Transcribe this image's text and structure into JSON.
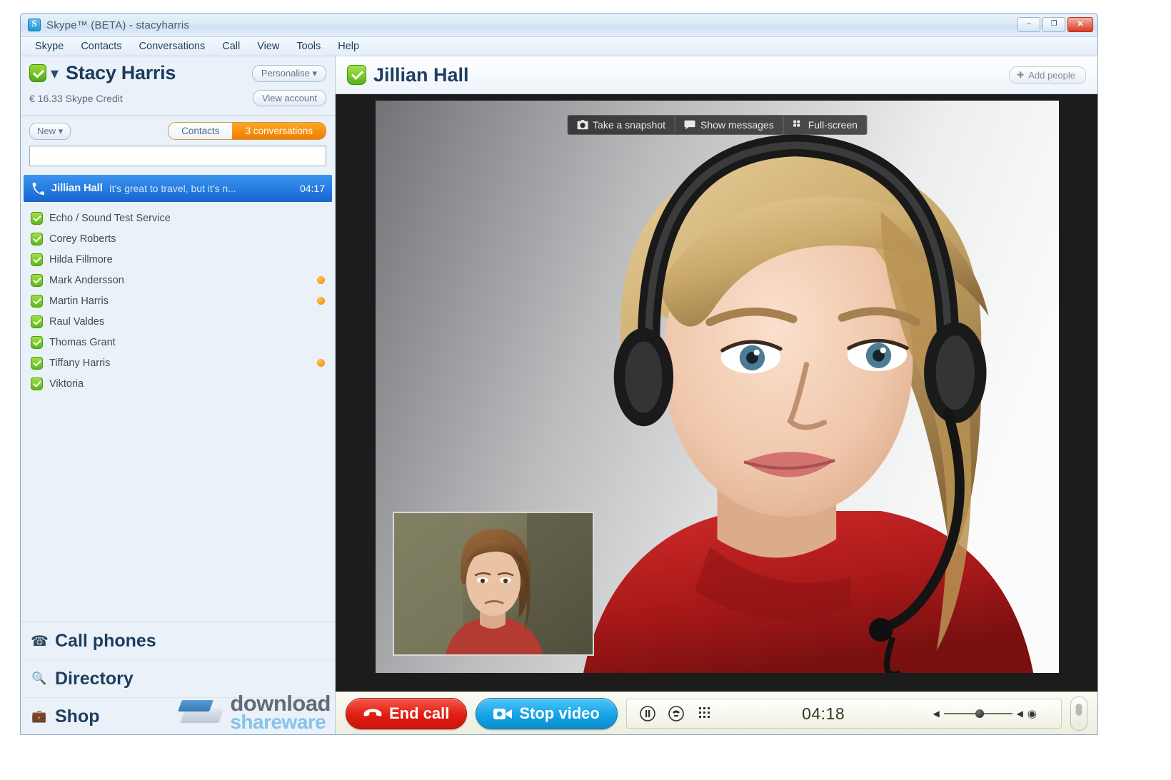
{
  "window": {
    "title": "Skype™ (BETA) - stacyharris",
    "icon": "skype-logo-icon",
    "minimize": "–",
    "maximize": "❐",
    "close": "✕"
  },
  "menubar": {
    "items": [
      "Skype",
      "Contacts",
      "Conversations",
      "Call",
      "View",
      "Tools",
      "Help"
    ]
  },
  "sidebar": {
    "account": {
      "name": "Stacy Harris",
      "presence": "online",
      "personalise_label": "Personalise",
      "personalise_caret": "▾",
      "credit": "€ 16.33 Skype Credit",
      "view_account_label": "View account"
    },
    "toolbar": {
      "new_label": "New",
      "new_caret": "▾",
      "tab_contacts": "Contacts",
      "tab_conversations": "3 conversations",
      "active_tab": "3 conversations"
    },
    "search": {
      "value": "",
      "placeholder": ""
    },
    "conversation": {
      "name": "Jillian Hall",
      "preview": "It's great to travel, but it's n...",
      "time": "04:17",
      "icon": "phone-icon",
      "selected": true
    },
    "contacts": [
      {
        "name": "Echo / Sound Test Service",
        "presence": "online",
        "badge": false
      },
      {
        "name": "Corey Roberts",
        "presence": "online",
        "badge": false
      },
      {
        "name": "Hilda Fillmore",
        "presence": "online",
        "badge": false
      },
      {
        "name": "Mark Andersson",
        "presence": "online",
        "badge": true
      },
      {
        "name": "Martin Harris",
        "presence": "online",
        "badge": true
      },
      {
        "name": "Raul Valdes",
        "presence": "online",
        "badge": false
      },
      {
        "name": "Thomas Grant",
        "presence": "online",
        "badge": false
      },
      {
        "name": "Tiffany Harris",
        "presence": "online",
        "badge": true
      },
      {
        "name": "Viktoria",
        "presence": "online",
        "badge": false
      }
    ],
    "bottom_nav": [
      {
        "label": "Call phones",
        "icon": "telephone-icon"
      },
      {
        "label": "Directory",
        "icon": "magnifier-icon"
      },
      {
        "label": "Shop",
        "icon": "shopping-bag-icon"
      }
    ],
    "watermark": {
      "line1": "download",
      "line2": "shareware"
    }
  },
  "conversation_panel": {
    "title": "Jillian Hall",
    "presence": "online",
    "add_people_label": "Add people",
    "add_people_icon": "plus-icon"
  },
  "video": {
    "toolbar": [
      {
        "label": "Take a snapshot",
        "icon": "camera-icon"
      },
      {
        "label": "Show messages",
        "icon": "chat-bubble-icon"
      },
      {
        "label": "Full-screen",
        "icon": "grid-icon"
      }
    ],
    "remote_participant": "Jillian Hall",
    "self_view_participant": "Stacy Harris"
  },
  "callbar": {
    "end_call_label": "End call",
    "end_call_icon": "hangup-icon",
    "end_call_color": "#e21d12",
    "stop_video_label": "Stop video",
    "stop_video_icon": "webcam-icon",
    "stop_video_color": "#14a3e8",
    "controls": [
      {
        "name": "hold-icon",
        "glyph": "❙❙"
      },
      {
        "name": "mute-icon",
        "glyph": "✆"
      },
      {
        "name": "dialpad-icon",
        "glyph": "⠿"
      }
    ],
    "timer": "04:18",
    "volume_icons": {
      "left": "◀",
      "right": "◀",
      "knob": "●",
      "speaker": "◉"
    },
    "mic_icon": "microphone-icon"
  },
  "colors": {
    "accent_orange": "#f07c00",
    "selection_blue": "#1666cf",
    "presence_green": "#53b012",
    "title_text": "#1d3f62"
  }
}
